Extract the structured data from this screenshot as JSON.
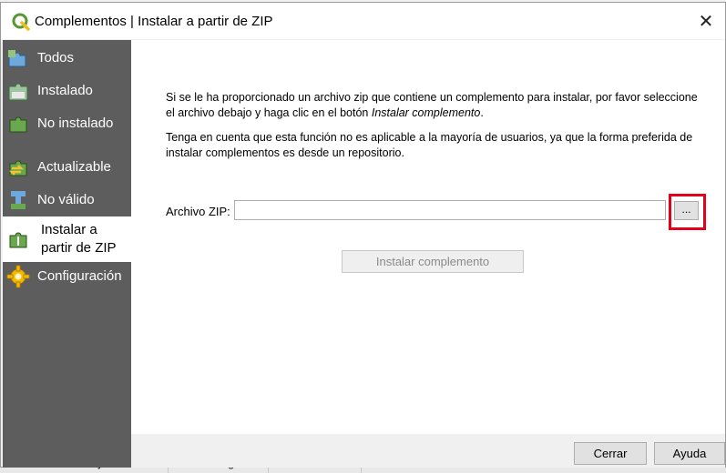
{
  "background": {
    "tabs": [
      "Advertencia de Python",
      "Processing",
      "Buscar"
    ]
  },
  "dialog": {
    "title": "Complementos | Instalar a partir de ZIP",
    "close_glyph": "✕"
  },
  "sidebar": {
    "items": [
      {
        "label": "Todos",
        "icon": "puzzle-all-icon"
      },
      {
        "label": "Instalado",
        "icon": "puzzle-installed-icon"
      },
      {
        "label": "No instalado",
        "icon": "puzzle-not-installed-icon"
      },
      {
        "label": "Actualizable",
        "icon": "puzzle-upgradeable-icon"
      },
      {
        "label": "No válido",
        "icon": "puzzle-invalid-icon"
      },
      {
        "label": "Instalar a partir de ZIP",
        "icon": "zip-install-icon",
        "active": true
      },
      {
        "label": "Configuración",
        "icon": "gear-icon"
      }
    ]
  },
  "main": {
    "paragraph1_a": "Si se le ha proporcionado un archivo zip que contiene un complemento para instalar, por favor seleccione el archivo debajo y haga clic en el botón ",
    "paragraph1_em": "Instalar complemento",
    "paragraph1_b": ".",
    "paragraph2": "Tenga en cuenta que esta función no es aplicable a la mayoría de usuarios, ya que la forma preferida de instalar complementos es desde un repositorio.",
    "zip_label": "Archivo ZIP:",
    "zip_value": "",
    "browse_label": "...",
    "install_label": "Instalar complemento"
  },
  "footer": {
    "close_label": "Cerrar",
    "help_label": "Ayuda"
  },
  "colors": {
    "highlight": "#e3001b",
    "sidebar_bg": "#5d5d5d"
  }
}
